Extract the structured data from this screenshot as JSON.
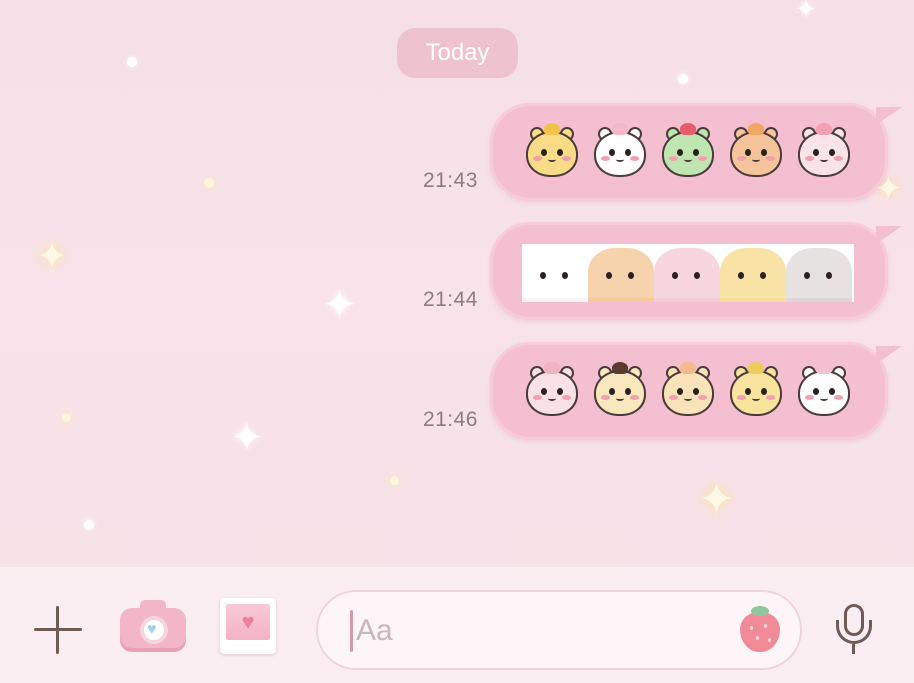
{
  "date_label": "Today",
  "messages": [
    {
      "time": "21:43",
      "sticker": "hamster-set-1",
      "characters": [
        {
          "name": "yellow-hamster",
          "color": "#f9dc85",
          "accent": "#f2c24a"
        },
        {
          "name": "white-hamster-bow",
          "color": "#ffffff",
          "accent": "#f4b8c8"
        },
        {
          "name": "green-hamster-cherry",
          "color": "#bfe6b0",
          "accent": "#e65c6b"
        },
        {
          "name": "orange-hamster-pancake",
          "color": "#f6c49a",
          "accent": "#f0a763"
        },
        {
          "name": "pink-hamster-peach",
          "color": "#fbe3ea",
          "accent": "#f59fb3"
        }
      ]
    },
    {
      "time": "21:44",
      "sticker": "hamster-closeup-strip",
      "characters": [
        {
          "name": "white-cat-face",
          "color": "#ffffff",
          "accent": "#f3c8d4"
        },
        {
          "name": "orange-hamster-face",
          "color": "#f6d3ad",
          "accent": "#f0a763"
        },
        {
          "name": "pink-hamster-face",
          "color": "#f7d6e0",
          "accent": "#e7a7b8"
        },
        {
          "name": "yellow-hamster-face",
          "color": "#f9e2a6",
          "accent": "#eec56e"
        },
        {
          "name": "grey-hamster-face",
          "color": "#e7e2e2",
          "accent": "#b8b0b0"
        }
      ]
    },
    {
      "time": "21:46",
      "sticker": "hamster-set-2",
      "characters": [
        {
          "name": "pink-hamster-shocked",
          "color": "#f9e1e7",
          "accent": "#f1b3c2"
        },
        {
          "name": "choco-hamster",
          "color": "#f9e7bd",
          "accent": "#5b3b30"
        },
        {
          "name": "peach-hamster",
          "color": "#fbe3b9",
          "accent": "#f4b98d"
        },
        {
          "name": "yellow-hamster-eating",
          "color": "#f9e49d",
          "accent": "#f0cd5a"
        },
        {
          "name": "white-hamster-smile",
          "color": "#ffffff",
          "accent": "#f3c1cf"
        }
      ]
    }
  ],
  "input": {
    "placeholder": "Aa"
  },
  "icons": {
    "plus": "plus-icon",
    "camera": "camera-icon",
    "photo": "photo-icon",
    "emoji": "strawberry-icon",
    "mic": "microphone-icon"
  },
  "colors": {
    "background": "#f7e1e8",
    "bubble": "#f4bfd0",
    "date_pill": "#efc2d0",
    "time_text": "#8e7b80",
    "input_bar": "#fbeef2"
  }
}
